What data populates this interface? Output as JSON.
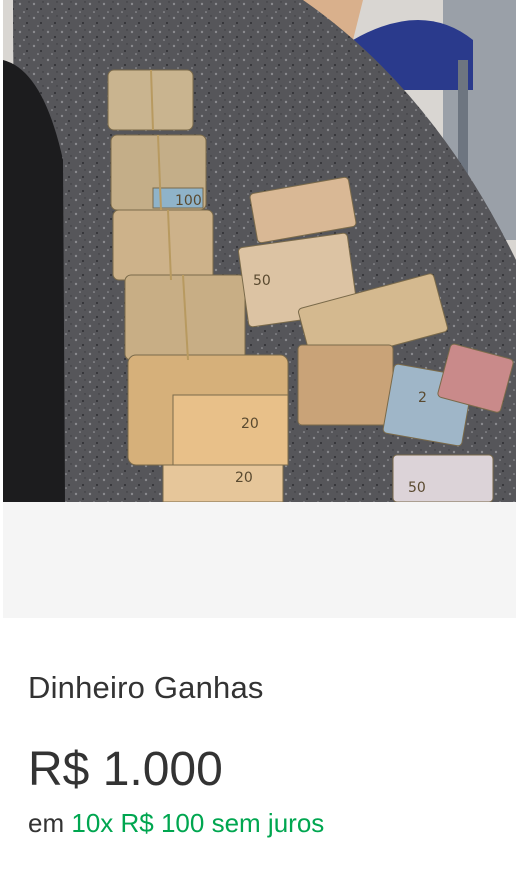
{
  "product": {
    "title": "Dinheiro Ganhas",
    "price": "R$ 1.000",
    "installments": {
      "prefix": "em",
      "amount": "10x R$ 100",
      "suffix": "sem juros"
    },
    "image_alt": "Pilhas de notas de dinheiro sobre uma mesa de granito"
  },
  "colors": {
    "text": "#333333",
    "installment_green": "#00a650",
    "image_bg": "#f5f5f5"
  }
}
